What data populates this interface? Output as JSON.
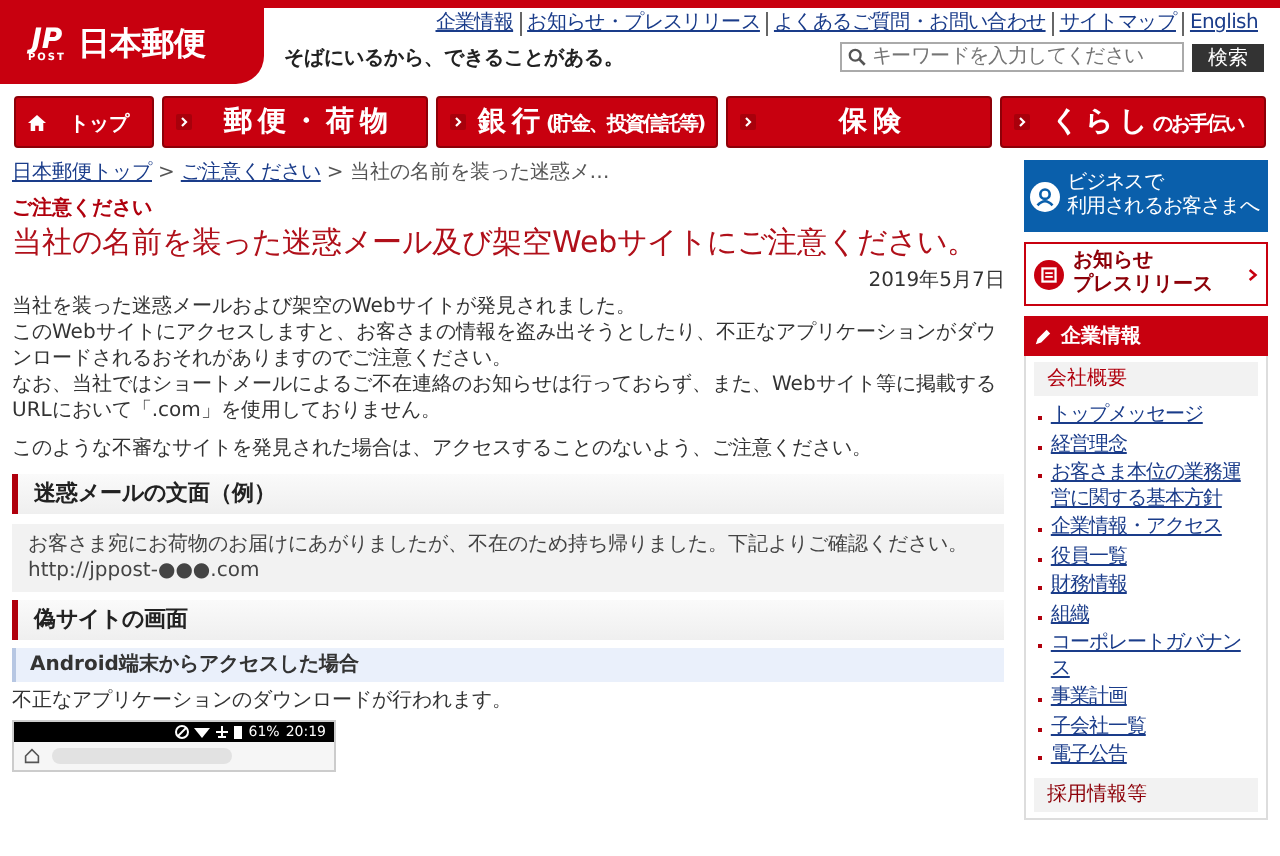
{
  "header": {
    "logo_mark": "JP",
    "logo_sub": "POST",
    "logo_text": "日本郵便",
    "tagline": "そばにいるから、できることがある。",
    "links": [
      "企業情報",
      "お知らせ・プレスリリース",
      "よくあるご質問・お問い合わせ",
      "サイトマップ",
      "English"
    ],
    "search": {
      "placeholder": "キーワードを入力してください",
      "button": "検索"
    }
  },
  "nav": [
    {
      "kind": "home",
      "label": "トップ"
    },
    {
      "kind": "menu",
      "label": "郵便・荷物"
    },
    {
      "kind": "menu",
      "label": "銀行",
      "sub": "(貯金、投資信託等)"
    },
    {
      "kind": "menu",
      "label": "保険"
    },
    {
      "kind": "menu",
      "label": "くらし",
      "sub": "のお手伝い"
    }
  ],
  "breadcrumb": [
    {
      "kind": "link",
      "text": "日本郵便トップ"
    },
    {
      "kind": "sep",
      "text": ">"
    },
    {
      "kind": "link",
      "text": "ご注意ください"
    },
    {
      "kind": "sep",
      "text": ">"
    },
    {
      "kind": "current",
      "text": "当社の名前を装った迷惑メ…"
    }
  ],
  "category": "ご注意ください",
  "title": "当社の名前を装った迷惑メール及び架空Webサイトにご注意ください。",
  "date": "2019年5月7日",
  "paragraphs": [
    [
      "当社を装った迷惑メールおよび架空のWebサイトが発見されました。",
      "このWebサイトにアクセスしますと、お客さまの情報を盗み出そうとしたり、不正なアプリケーションがダウンロードされるおそれがありますのでご注意ください。",
      "なお、当社ではショートメールによるご不在連絡のお知らせは行っておらず、また、Webサイト等に掲載するURLにおいて「.com」を使用しておりません。"
    ],
    [
      "このような不審なサイトを発見された場合は、アクセスすることのないよう、ご注意ください。"
    ]
  ],
  "mail_heading": "迷惑メールの文面（例）",
  "mail_example": [
    "お客さま宛にお荷物のお届けにあがりましたが、不在のため持ち帰りました。下記よりご確認ください。",
    "http://jppost-●●●.com"
  ],
  "fake_heading": "偽サイトの画面",
  "android_heading": "Android端末からアクセスした場合",
  "android_text": "不正なアプリケーションのダウンロードが行われます。",
  "phone": {
    "battery": "61%",
    "time": "20:19"
  },
  "sidebar": {
    "business": [
      "ビジネスで",
      "利用されるお客さまへ"
    ],
    "news": [
      "お知らせ",
      "プレスリリース"
    ],
    "corp_heading": "企業情報",
    "company_heading": "会社概要",
    "items": [
      "トップメッセージ",
      "経営理念",
      "お客さま本位の業務運営に関する基本方針",
      "企業情報・アクセス",
      "役員一覧",
      "財務情報",
      "組織",
      "コーポレートガバナンス",
      "事業計画",
      "子会社一覧",
      "電子公告"
    ],
    "recruit_heading": "採用情報等"
  }
}
